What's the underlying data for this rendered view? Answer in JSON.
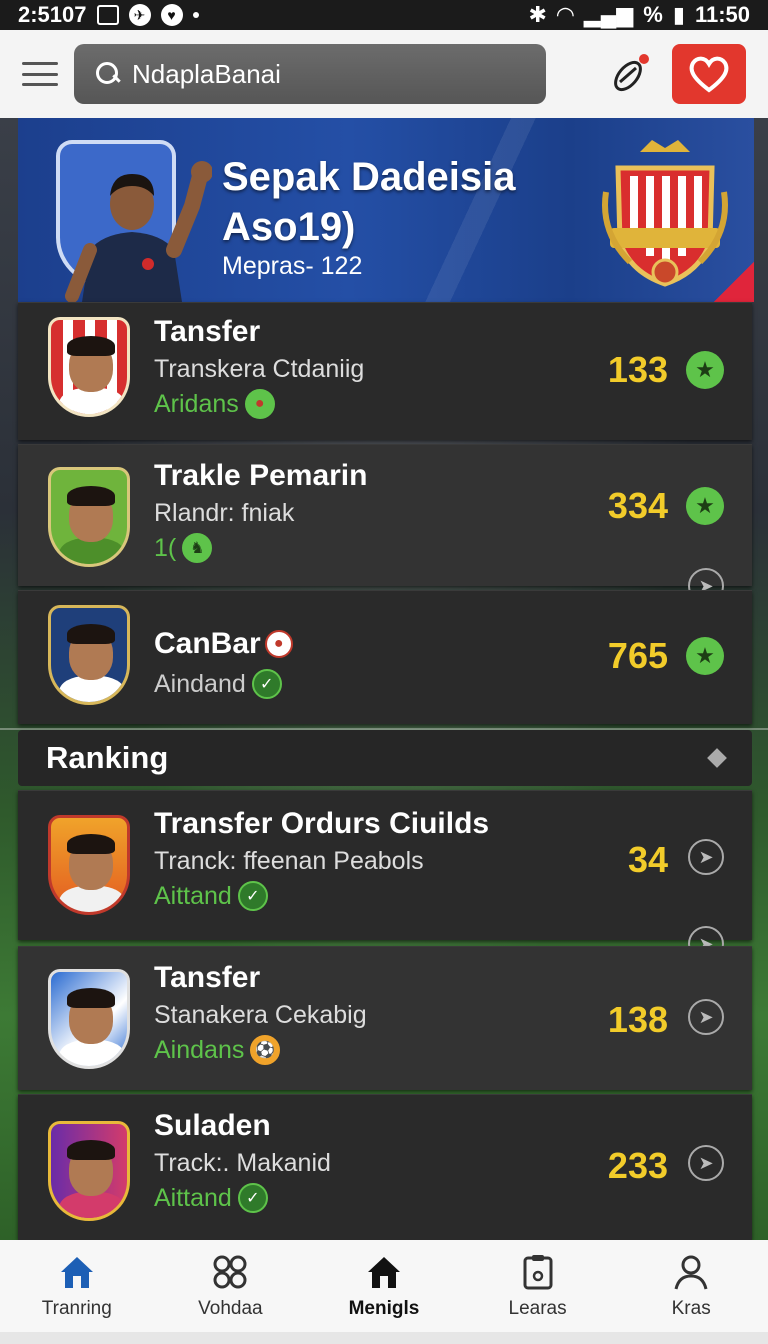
{
  "status_bar": {
    "time_left": "2:5107",
    "battery": "%",
    "time_right": "11:50"
  },
  "header": {
    "search_text": "NdaplaBanai"
  },
  "hero": {
    "title": "Sepak Dadeisia\nAso19)",
    "subtitle": "Mepras- 122"
  },
  "cards": [
    {
      "title": "Tansfer",
      "sub": "Transkera Ctdaniig",
      "tag": "Aridans",
      "score": "133"
    },
    {
      "title": "Trakle Pemarin",
      "sub": "Rlandr: fniak",
      "tag": "1(",
      "score": "334"
    },
    {
      "title": "CanBar",
      "sub": "",
      "tag": "Aindand",
      "score": "765"
    }
  ],
  "ranking": {
    "label": "Ranking",
    "items": [
      {
        "title": "Transfer Ordurs Ciuilds",
        "sub": "Tranck: ffeenan Peabols",
        "tag": "Aittand",
        "score": "34"
      },
      {
        "title": "Tansfer",
        "sub": "Stanakera Cekabig",
        "tag": "Aindans",
        "score": "138"
      },
      {
        "title": "Suladen",
        "sub": "Track:. Makanid",
        "tag": "Aittand",
        "score": "233"
      }
    ]
  },
  "nav": [
    {
      "label": "Tranring",
      "icon": "home-icon"
    },
    {
      "label": "Vohdaa",
      "icon": "grid-icon"
    },
    {
      "label": "Menigls",
      "icon": "home-icon"
    },
    {
      "label": "Learas",
      "icon": "clipboard-icon"
    },
    {
      "label": "Kras",
      "icon": "profile-icon"
    }
  ],
  "colors": {
    "accent_red": "#e2372d",
    "score_yellow": "#f2cc2a",
    "tag_green": "#5ec34a",
    "nav_active_blue": "#1d5fb5"
  }
}
